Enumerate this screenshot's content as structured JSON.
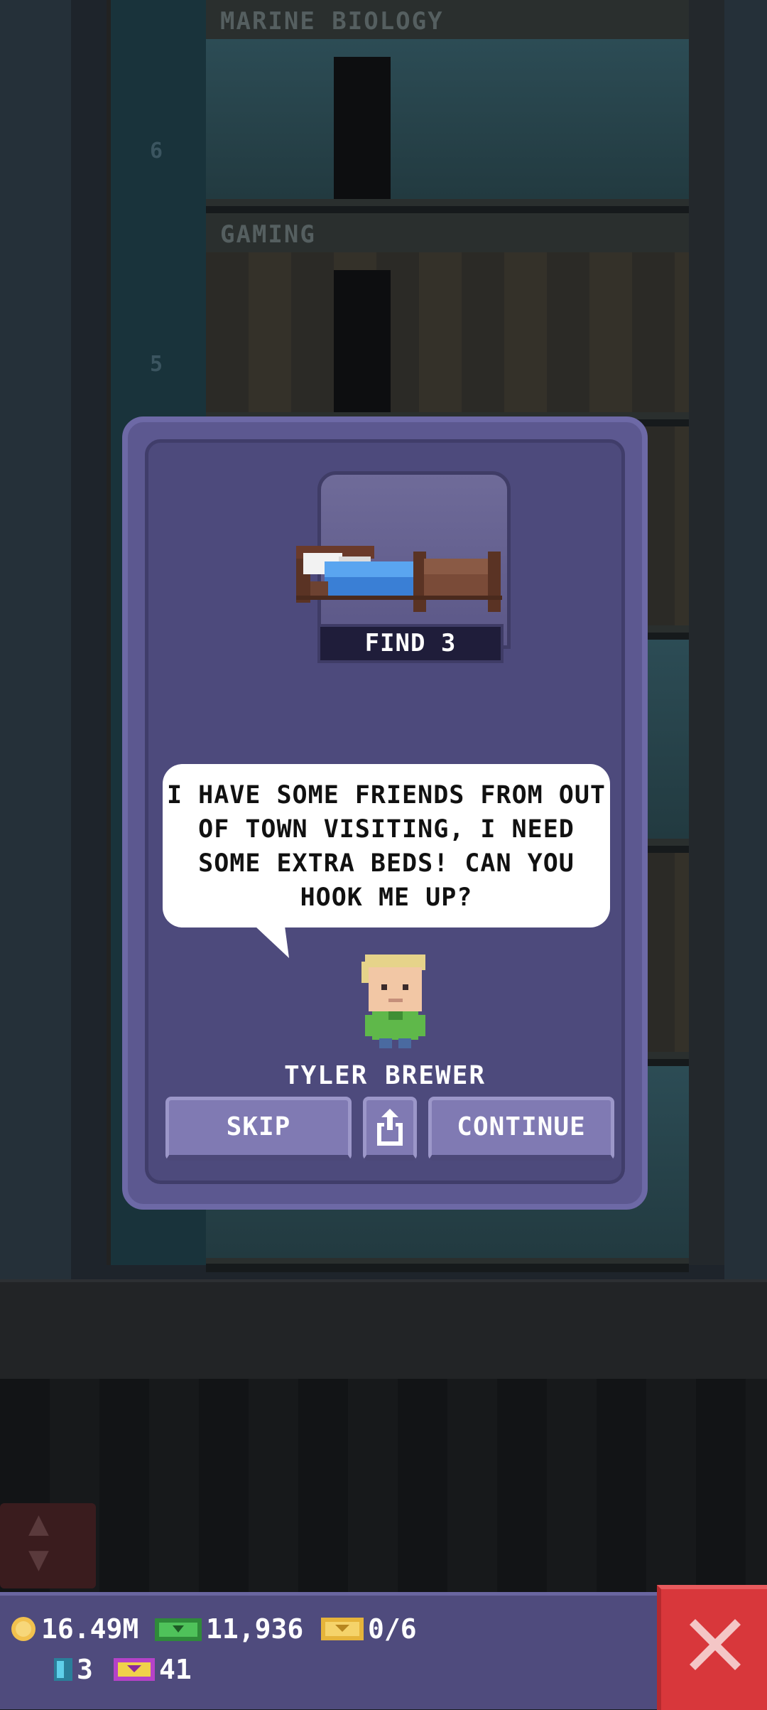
{
  "background": {
    "floors": [
      {
        "number": "6",
        "label": "MARINE BIOLOGY"
      },
      {
        "number": "5",
        "label": "GAMING"
      }
    ]
  },
  "dialog": {
    "find_label": "FIND 3",
    "item_icon": "bed-icon",
    "message": "I HAVE SOME FRIENDS FROM OUT OF TOWN VISITING, I NEED SOME EXTRA BEDS! CAN YOU HOOK ME UP?",
    "character_name": "TYLER BREWER",
    "buttons": {
      "skip": "SKIP",
      "share_icon": "share-icon",
      "continue": "CONTINUE"
    }
  },
  "hud": {
    "coins": "16.49M",
    "bux": "11,936",
    "tickets": "0/6",
    "gems": "3",
    "golden_tickets": "41",
    "close_icon": "close-icon"
  },
  "colors": {
    "dialog_bg": "#5c5890",
    "button_bg": "#807ab3",
    "close_red": "#d8373b",
    "bed_blue": "#3a7fd5"
  }
}
